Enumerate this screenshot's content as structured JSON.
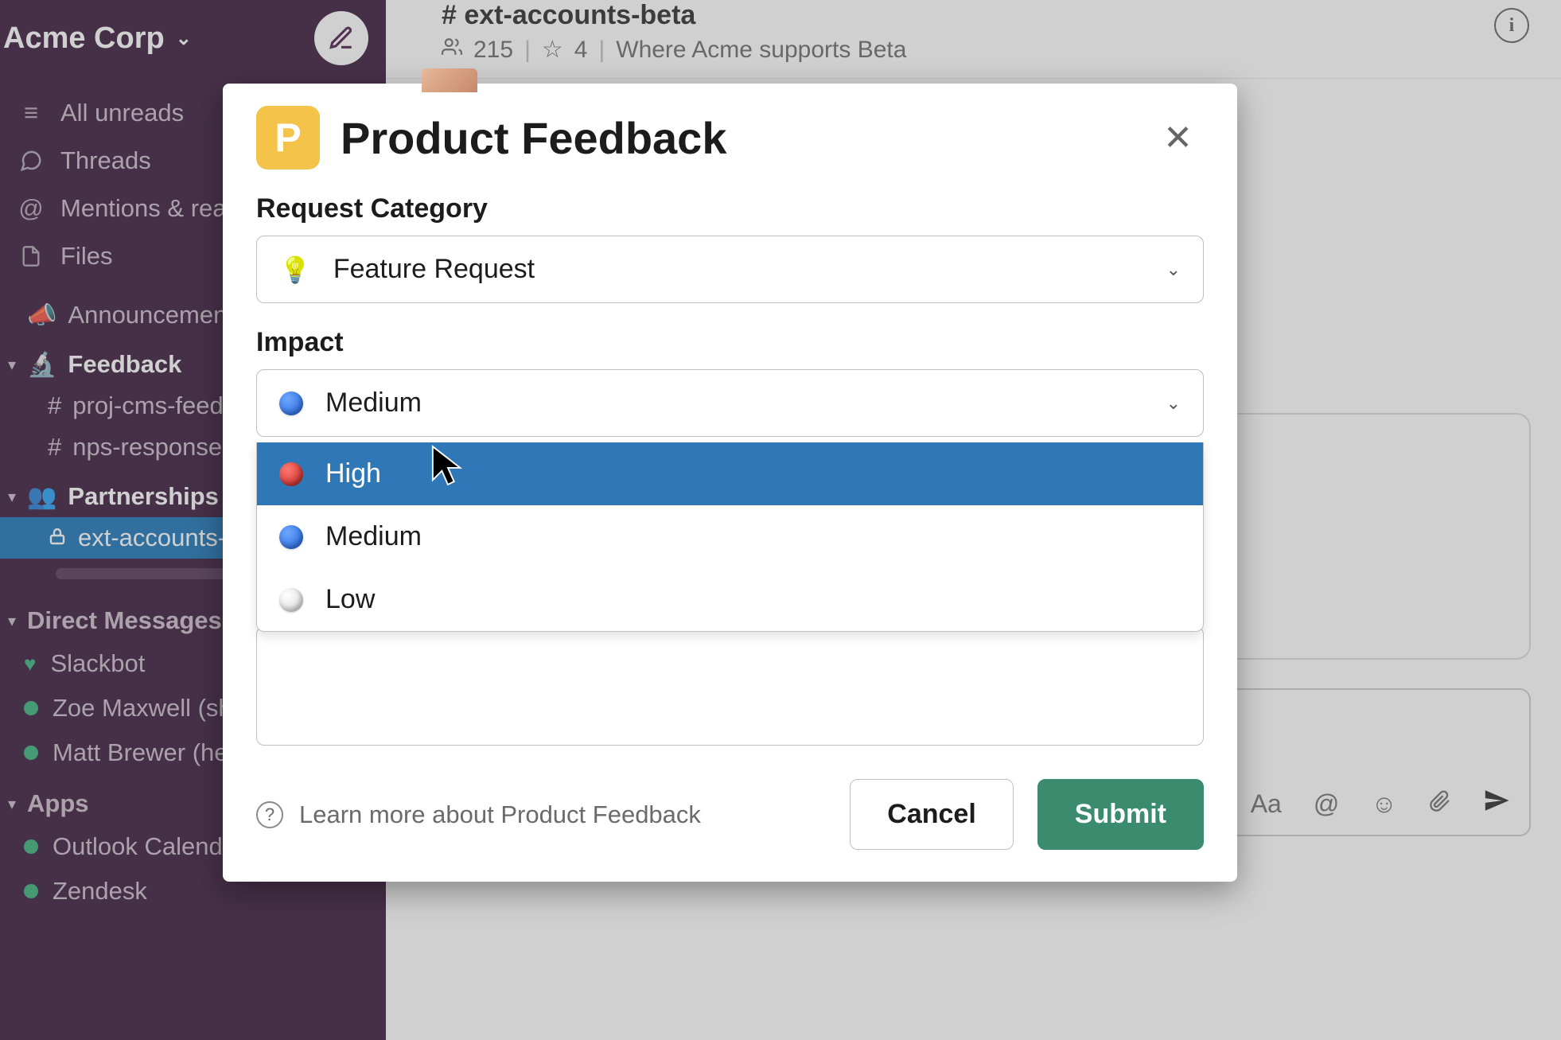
{
  "workspace": {
    "name": "Acme Corp"
  },
  "nav": {
    "unreads": "All unreads",
    "threads": "Threads",
    "mentions": "Mentions & reactions",
    "files": "Files"
  },
  "sections": {
    "announcements": "Announcements",
    "feedback": "Feedback",
    "partnerships": "Partnerships",
    "dms": "Direct Messages",
    "apps": "Apps"
  },
  "channels": {
    "proj_cms": "proj-cms-feedback",
    "nps": "nps-responses",
    "ext_accounts": "ext-accounts-beta"
  },
  "dms": {
    "slackbot": "Slackbot",
    "zoe": "Zoe Maxwell (she/her)",
    "matt": "Matt Brewer (he/him)"
  },
  "apps": {
    "outlook": "Outlook Calendar",
    "zendesk": "Zendesk"
  },
  "header": {
    "channel_prefix": "# ",
    "channel_name": "ext-accounts-beta",
    "member_count": "215",
    "pin_count": "4",
    "topic": "Where Acme supports Beta"
  },
  "modal": {
    "badge_letter": "P",
    "title": "Product Feedback",
    "category_label": "Request Category",
    "category_value": "Feature Request",
    "category_icon": "lightbulb-icon",
    "impact_label": "Impact",
    "impact_selected": "Medium",
    "impact_options": [
      {
        "label": "High",
        "color": "red"
      },
      {
        "label": "Medium",
        "color": "blue"
      },
      {
        "label": "Low",
        "color": "white"
      }
    ],
    "learn_more": "Learn more about Product Feedback",
    "cancel": "Cancel",
    "submit": "Submit"
  }
}
